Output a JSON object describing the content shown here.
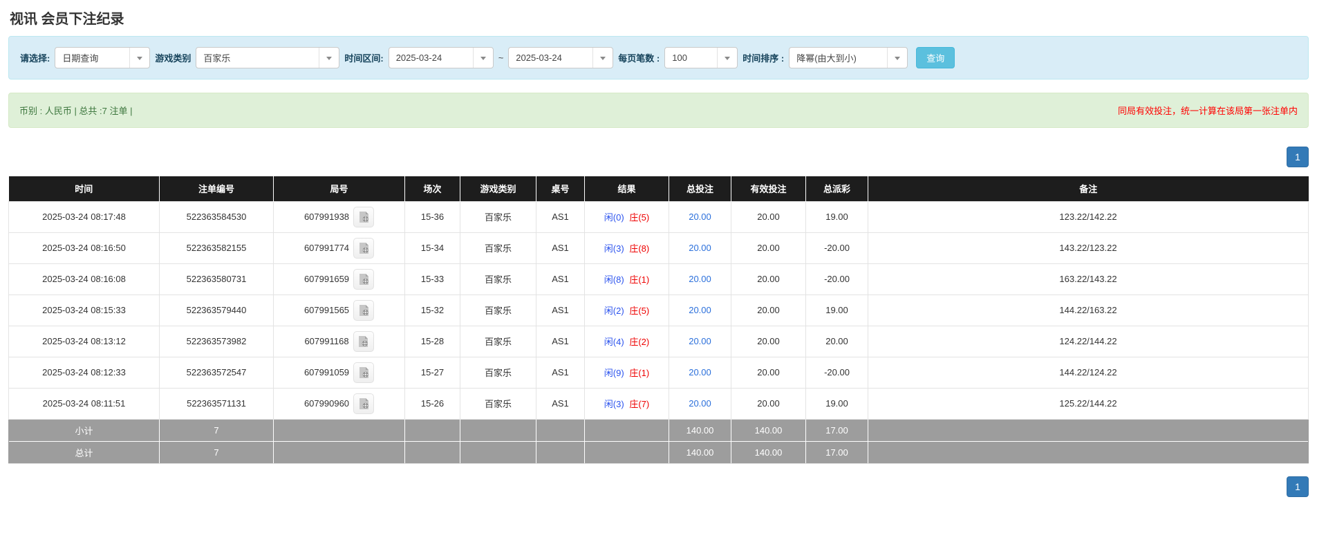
{
  "page": {
    "title": "视讯 会员下注纪录"
  },
  "filters": {
    "select_label": "请选择:",
    "select_value": "日期查询",
    "game_type_label": "游戏类别",
    "game_type_value": "百家乐",
    "date_range_label": "时间区间:",
    "date_from": "2025-03-24",
    "date_separator": "~",
    "date_to": "2025-03-24",
    "page_size_label": "每页笔数 :",
    "page_size_value": "100",
    "sort_label": "时间排序 :",
    "sort_value": "降幂(由大到小)",
    "search_button": "查询"
  },
  "summary": {
    "left_text": "币别 : 人民币 | 总共 :7 注单 |",
    "right_notice": "同局有效投注，统一计算在该局第一张注单内"
  },
  "pagination": {
    "page": "1"
  },
  "table": {
    "columns": [
      "时间",
      "注单编号",
      "局号",
      "场次",
      "游戏类别",
      "桌号",
      "结果",
      "总投注",
      "有效投注",
      "总派彩",
      "备注"
    ],
    "rows": [
      {
        "time": "2025-03-24 08:17:48",
        "bet_id": "522363584530",
        "round_id": "607991938",
        "session": "15-36",
        "game": "百家乐",
        "table": "AS1",
        "result_player": "闲(0)",
        "result_banker": "庄(5)",
        "total_bet": "20.00",
        "valid_bet": "20.00",
        "payout": "19.00",
        "payout_negative": false,
        "remark": "123.22/142.22"
      },
      {
        "time": "2025-03-24 08:16:50",
        "bet_id": "522363582155",
        "round_id": "607991774",
        "session": "15-34",
        "game": "百家乐",
        "table": "AS1",
        "result_player": "闲(3)",
        "result_banker": "庄(8)",
        "total_bet": "20.00",
        "valid_bet": "20.00",
        "payout": "-20.00",
        "payout_negative": true,
        "remark": "143.22/123.22"
      },
      {
        "time": "2025-03-24 08:16:08",
        "bet_id": "522363580731",
        "round_id": "607991659",
        "session": "15-33",
        "game": "百家乐",
        "table": "AS1",
        "result_player": "闲(8)",
        "result_banker": "庄(1)",
        "total_bet": "20.00",
        "valid_bet": "20.00",
        "payout": "-20.00",
        "payout_negative": true,
        "remark": "163.22/143.22"
      },
      {
        "time": "2025-03-24 08:15:33",
        "bet_id": "522363579440",
        "round_id": "607991565",
        "session": "15-32",
        "game": "百家乐",
        "table": "AS1",
        "result_player": "闲(2)",
        "result_banker": "庄(5)",
        "total_bet": "20.00",
        "valid_bet": "20.00",
        "payout": "19.00",
        "payout_negative": false,
        "remark": "144.22/163.22"
      },
      {
        "time": "2025-03-24 08:13:12",
        "bet_id": "522363573982",
        "round_id": "607991168",
        "session": "15-28",
        "game": "百家乐",
        "table": "AS1",
        "result_player": "闲(4)",
        "result_banker": "庄(2)",
        "total_bet": "20.00",
        "valid_bet": "20.00",
        "payout": "20.00",
        "payout_negative": false,
        "remark": "124.22/144.22"
      },
      {
        "time": "2025-03-24 08:12:33",
        "bet_id": "522363572547",
        "round_id": "607991059",
        "session": "15-27",
        "game": "百家乐",
        "table": "AS1",
        "result_player": "闲(9)",
        "result_banker": "庄(1)",
        "total_bet": "20.00",
        "valid_bet": "20.00",
        "payout": "-20.00",
        "payout_negative": true,
        "remark": "144.22/124.22"
      },
      {
        "time": "2025-03-24 08:11:51",
        "bet_id": "522363571131",
        "round_id": "607990960",
        "session": "15-26",
        "game": "百家乐",
        "table": "AS1",
        "result_player": "闲(3)",
        "result_banker": "庄(7)",
        "total_bet": "20.00",
        "valid_bet": "20.00",
        "payout": "19.00",
        "payout_negative": false,
        "remark": "125.22/144.22"
      }
    ],
    "subtotal": {
      "label": "小计",
      "count": "7",
      "total_bet": "140.00",
      "valid_bet": "140.00",
      "payout": "17.00"
    },
    "grand_total": {
      "label": "总计",
      "count": "7",
      "total_bet": "140.00",
      "valid_bet": "140.00",
      "payout": "17.00"
    }
  },
  "colors": {
    "player_blue": "#2a52ee",
    "banker_red": "#ee0000",
    "link_blue": "#2a6fdb",
    "negative_red": "#ee0000",
    "notice_red": "#ff0000",
    "header_bg": "#1d1d1d",
    "footer_bg": "#9d9d9d",
    "panel_bg": "#d9edf7",
    "alert_bg": "#dff0d8",
    "query_button_cyan": "#5bc0de",
    "pager_blue": "#337ab7"
  }
}
